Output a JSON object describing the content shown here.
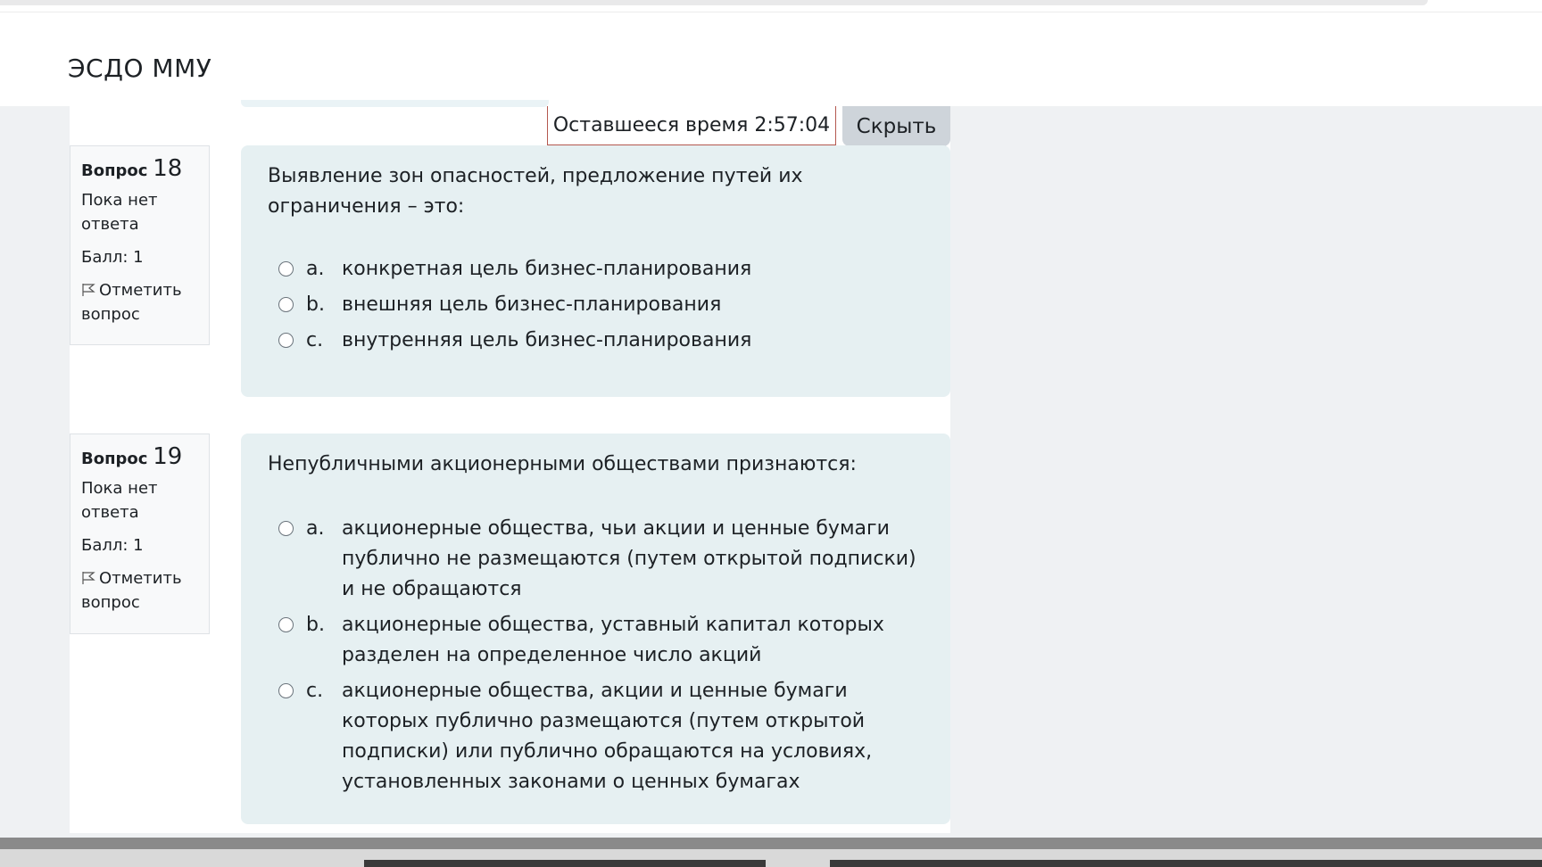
{
  "header": {
    "site_title": "ЭСДО ММУ"
  },
  "timer": {
    "label": "Оставшееся время 2:57:04",
    "hide_button": "Скрыть"
  },
  "questions": [
    {
      "label": "Вопрос",
      "number": "18",
      "status": "Пока нет ответа",
      "grade": "Балл: 1",
      "flag_label": "Отметить вопрос",
      "text": "Выявление зон опасностей, предложение путей их ограничения – это:",
      "answers": [
        {
          "letter": "a.",
          "text": "конкретная цель бизнес-планирования"
        },
        {
          "letter": "b.",
          "text": "внешняя цель бизнес-планирования"
        },
        {
          "letter": "c.",
          "text": "внутренняя цель бизнес-планирования"
        }
      ]
    },
    {
      "label": "Вопрос",
      "number": "19",
      "status": "Пока нет ответа",
      "grade": "Балл: 1",
      "flag_label": "Отметить вопрос",
      "text": "Непубличными акционерными обществами признаются:",
      "answers": [
        {
          "letter": "a.",
          "text": "акционерные общества, чьи акции и ценные бумаги публично не размещаются (путем открытой подписки) и не обращаются"
        },
        {
          "letter": "b.",
          "text": "акционерные общества, уставный капитал которых разделен на определенное число акций"
        },
        {
          "letter": "c.",
          "text": "акционерные общества, акции и ценные бумаги которых публично размещаются (путем открытой подписки) или публично обращаются на условиях, установленных законами о ценных бумагах"
        }
      ]
    }
  ]
}
